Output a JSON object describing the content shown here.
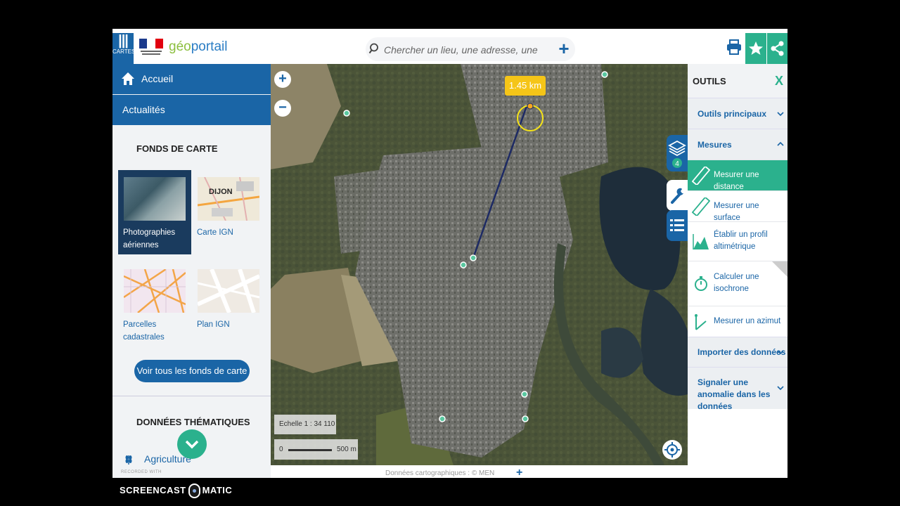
{
  "header": {
    "cartes_label": "CARTES",
    "logo_prefix": "géo",
    "logo_suffix": "portail",
    "search_placeholder": "Chercher un lieu, une adresse, une donnée",
    "search_plus": "+"
  },
  "left": {
    "nav_home": "Accueil",
    "nav_news": "Actualités",
    "fonds_title": "FONDS DE CARTE",
    "cards": [
      {
        "label": "Photographies aériennes"
      },
      {
        "label": "Carte IGN",
        "thumb_text": "DIJON"
      },
      {
        "label": "Parcelles cadastrales"
      },
      {
        "label": "Plan IGN"
      }
    ],
    "voir_button": "Voir tous les fonds de carte",
    "thematiques_title": "DONNÉES THÉMATIQUES",
    "agriculture": "Agriculture"
  },
  "map": {
    "zoom_in": "+",
    "zoom_out": "−",
    "distance_label": "1.45 km",
    "scale_text": "Echelle 1 : 34 110",
    "scale_zero": "0",
    "scale_distance": "500 m",
    "layers_count": "4"
  },
  "tools": {
    "title": "OUTILS",
    "close": "X",
    "sections": {
      "principaux": "Outils principaux",
      "mesures": "Mesures",
      "importer": "Importer des données",
      "signaler": "Signaler une anomalie dans les données"
    },
    "items": {
      "distance": "Mesurer une distance",
      "surface": "Mesurer une surface",
      "profil": "Établir un profil altimétrique",
      "isochrone": "Calculer une isochrone",
      "azimut": "Mesurer un azimut"
    }
  },
  "footer": {
    "copyright": "Données cartographiques : ©  MEN",
    "plus": "+",
    "recorded": "RECORDED WITH"
  },
  "watermark": {
    "left": "SCREENCAST",
    "right": "MATIC"
  }
}
